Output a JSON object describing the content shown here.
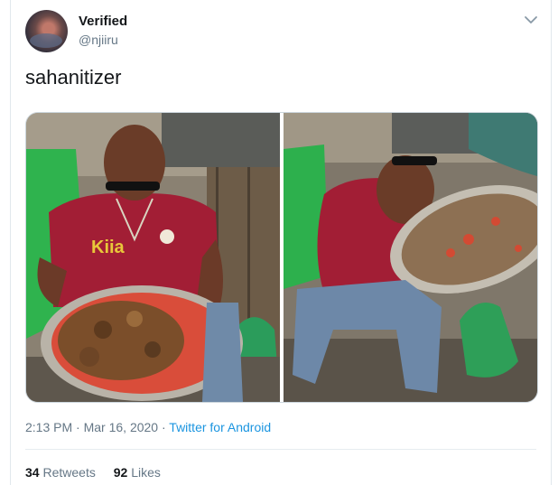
{
  "user": {
    "display_name": "Verified",
    "handle": "@njiiru"
  },
  "tweet": {
    "text": "sahanitizer"
  },
  "meta": {
    "time": "2:13 PM",
    "date": "Mar 16, 2020",
    "source": "Twitter for Android"
  },
  "stats": {
    "retweets_count": "34",
    "retweets_label": "Retweets",
    "likes_count": "92",
    "likes_label": "Likes"
  },
  "icons": {
    "menu": "chevron-down-icon"
  }
}
